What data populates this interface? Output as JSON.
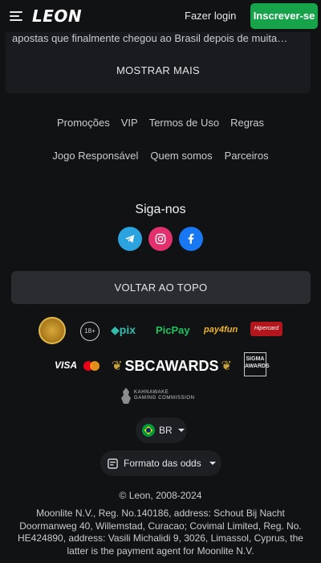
{
  "header": {
    "logo": "LEON",
    "login_label": "Fazer login",
    "register_label": "Inscrever-se"
  },
  "top_card": {
    "description": "apostas que finalmente chegou ao Brasil depois de muita…",
    "show_more_label": "MOSTRAR MAIS"
  },
  "footer_links": {
    "row1": [
      "Promoções",
      "VIP",
      "Termos de Uso",
      "Regras"
    ],
    "row2": [
      "Jogo Responsável",
      "Quem somos",
      "Parceiros"
    ]
  },
  "social": {
    "title": "Siga-nos",
    "icons": [
      "telegram-icon",
      "instagram-icon",
      "facebook-icon"
    ]
  },
  "back_to_top_label": "VOLTAR AO TOPO",
  "partners": {
    "age": "18+",
    "pix": "pix",
    "picpay": "PicPay",
    "payfun": "pay4fun",
    "hipercard": "Hipercard",
    "visa": "VISA",
    "sbc": "SBCAWARDS",
    "sigma": "SIGMA AWARDS",
    "kahnawake_line1": "KAHNAWAKE",
    "kahnawake_line2": "GAMING COMMISSION"
  },
  "language_selector": {
    "value": "BR"
  },
  "odds_selector": {
    "label": "Formato das odds"
  },
  "copyright": "© Leon, 2008-2024",
  "legal_text": "Moonlite N.V., Reg. No.140186, address: Schout Bij Nacht Doormanweg 40, Willemstad, Curacao; Covimal Limited, Reg. No. HE424890, address: Vasili Michalidi 9, 3026, Limassol, Cyprus, the latter is the payment agent for Moonlite N.V.",
  "colors": {
    "background": "#111214",
    "accent_green": "#16a34a",
    "card": "#1a1b1e",
    "button": "#2a2c30"
  }
}
